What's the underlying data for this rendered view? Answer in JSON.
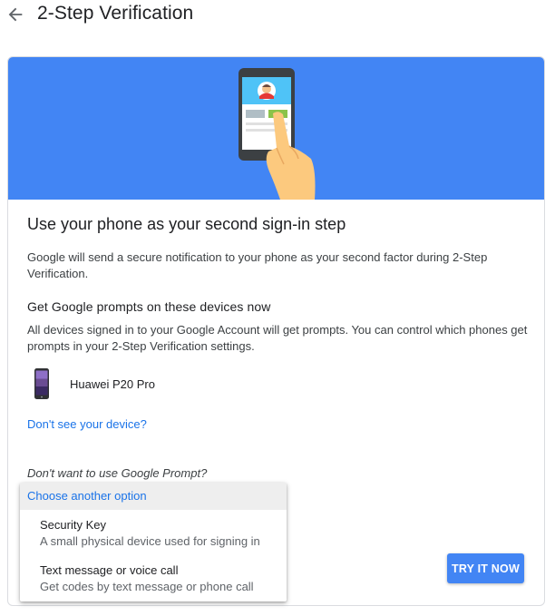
{
  "header": {
    "back_icon": "arrow-left-icon",
    "title": "2-Step Verification"
  },
  "card": {
    "banner_color": "#4285f4",
    "banner_illustration": "phone-with-hand-illustration",
    "title": "Use your phone as your second sign-in step",
    "description": "Google will send a secure notification to your phone as your second factor during 2-Step Verification.",
    "subheading": "Get Google prompts on these devices now",
    "subheading_description": "All devices signed in to your Google Account will get prompts. You can control which phones get prompts in your 2-Step Verification settings.",
    "device": {
      "icon": "smartphone-icon",
      "name": "Huawei P20 Pro"
    },
    "missing_device_link": "Don't see your device?",
    "alternative_question": "Don't want to use Google Prompt?",
    "primary_button": "TRY IT NOW"
  },
  "options_menu": {
    "header": "Choose another option",
    "items": [
      {
        "title": "Security Key",
        "subtitle": "A small physical device used for signing in"
      },
      {
        "title": "Text message or voice call",
        "subtitle": "Get codes by text message or phone call"
      }
    ]
  },
  "colors": {
    "accent": "#1a73e8",
    "button": "#4285f4",
    "menu_header_bg": "#eeeeee"
  }
}
